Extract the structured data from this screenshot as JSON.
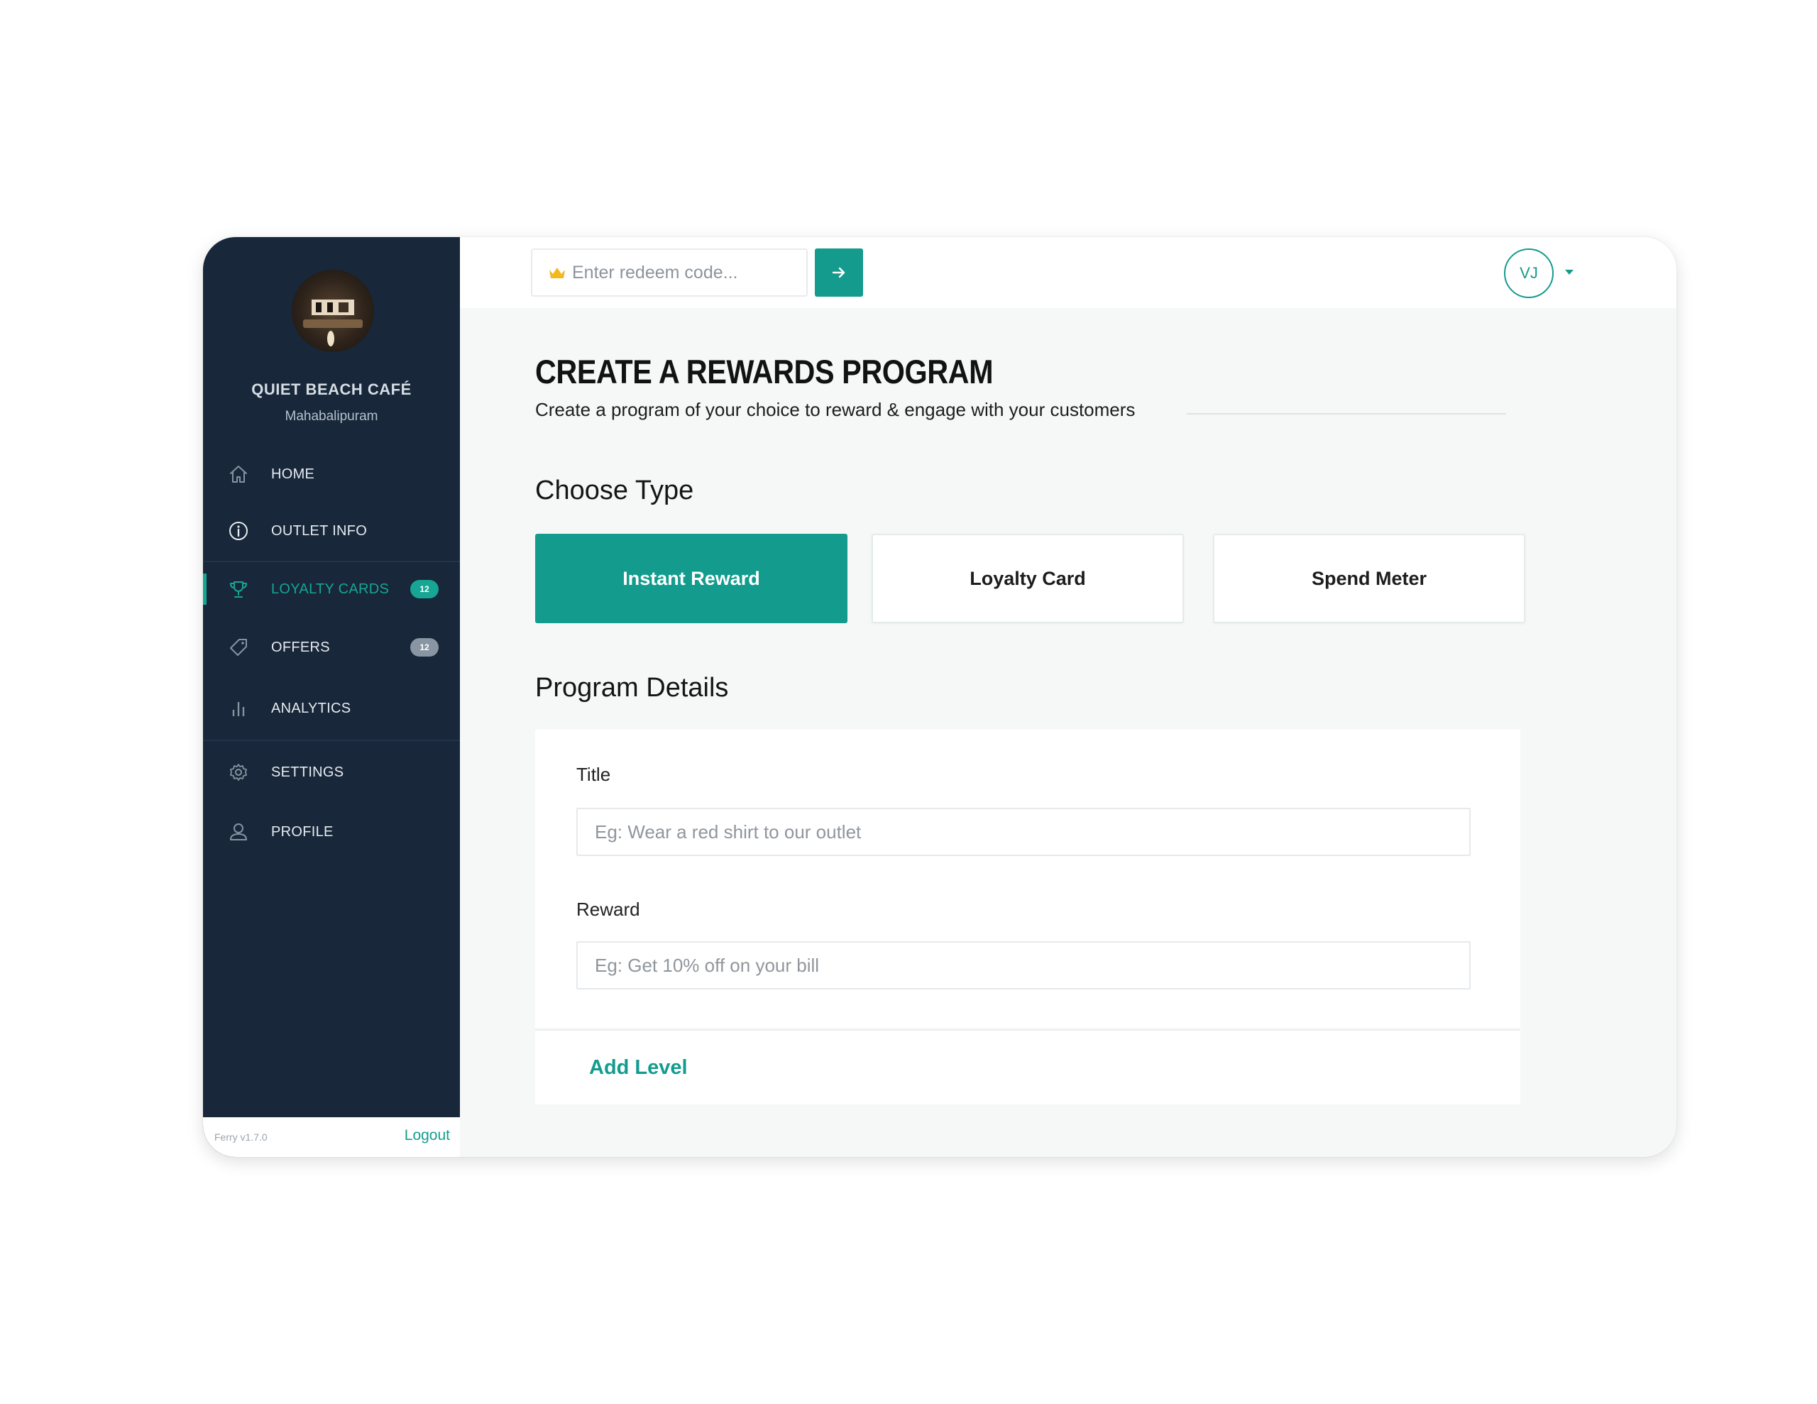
{
  "sidebar": {
    "cafe_name": "QUIET BEACH CAFÉ",
    "cafe_location": "Mahabalipuram",
    "items": [
      {
        "label": "HOME",
        "icon": "home-icon"
      },
      {
        "label": "OUTLET INFO",
        "icon": "info-icon"
      },
      {
        "label": "LOYALTY CARDS",
        "icon": "trophy-icon",
        "badge": "12",
        "active": true
      },
      {
        "label": "OFFERS",
        "icon": "tag-icon",
        "badge": "12"
      },
      {
        "label": "ANALYTICS",
        "icon": "bar-chart-icon"
      },
      {
        "label": "SETTINGS",
        "icon": "gear-icon"
      },
      {
        "label": "PROFILE",
        "icon": "user-icon"
      }
    ],
    "version": "Ferry v1.7.0",
    "logout_label": "Logout"
  },
  "topbar": {
    "redeem_placeholder": "Enter redeem code...",
    "user_initials": "VJ"
  },
  "main": {
    "title": "CREATE A REWARDS PROGRAM",
    "subtitle": "Create a program of your choice to reward & engage with your customers",
    "choose_type_heading": "Choose Type",
    "types": [
      {
        "label": "Instant Reward",
        "selected": true
      },
      {
        "label": "Loyalty Card",
        "selected": false
      },
      {
        "label": "Spend Meter",
        "selected": false
      }
    ],
    "program_details_heading": "Program Details",
    "title_label": "Title",
    "title_placeholder": "Eg: Wear a red shirt to our outlet",
    "reward_label": "Reward",
    "reward_placeholder": "Eg: Get 10% off on your bill",
    "add_level_label": "Add Level"
  },
  "colors": {
    "sidebar_bg": "#18273a",
    "accent": "#139c8e",
    "page_bg": "#f6f8f8"
  }
}
